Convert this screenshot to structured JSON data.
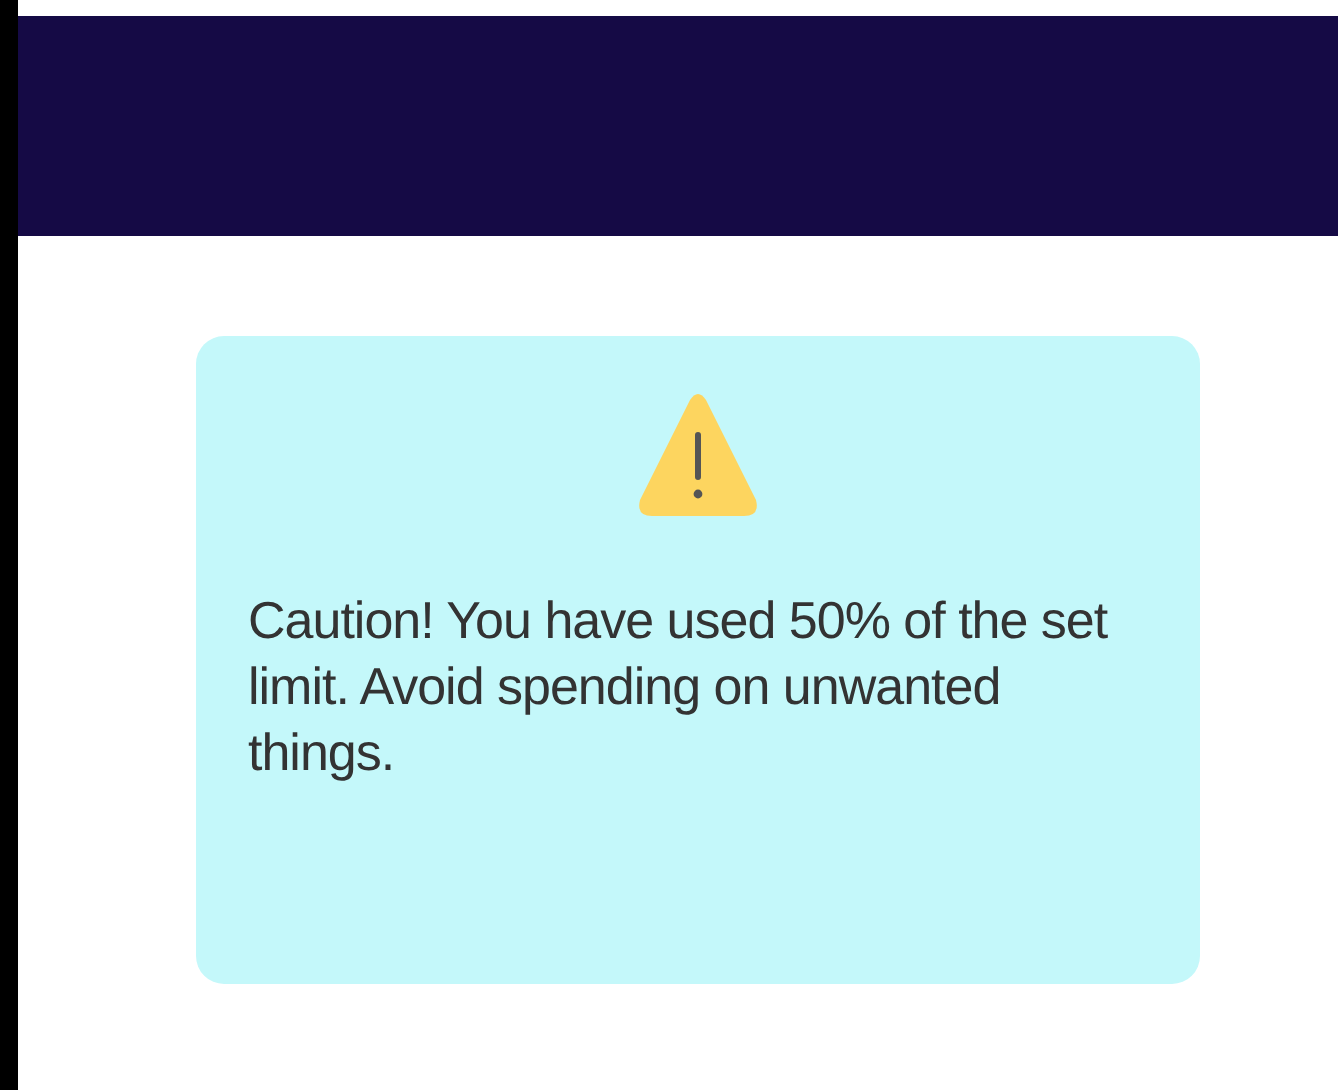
{
  "alert": {
    "message": "Caution! You have used 50% of the set limit. Avoid spending on unwanted things."
  }
}
